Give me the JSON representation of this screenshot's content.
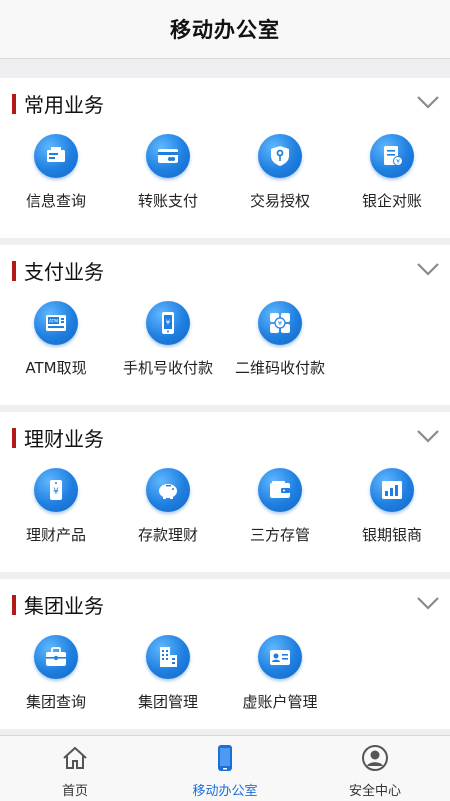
{
  "header": {
    "title": "移动办公室"
  },
  "sections": [
    {
      "title": "常用业务",
      "items": [
        {
          "label": "信息查询",
          "icon": "info-board-icon"
        },
        {
          "label": "转账支付",
          "icon": "card-icon"
        },
        {
          "label": "交易授权",
          "icon": "shield-key-icon"
        },
        {
          "label": "银企对账",
          "icon": "document-yen-icon"
        }
      ]
    },
    {
      "title": "支付业务",
      "items": [
        {
          "label": "ATM取现",
          "icon": "atm-icon"
        },
        {
          "label": "手机号收付款",
          "icon": "phone-yen-icon"
        },
        {
          "label": "二维码收付款",
          "icon": "grid-yen-icon"
        }
      ]
    },
    {
      "title": "理财业务",
      "items": [
        {
          "label": "理财产品",
          "icon": "tag-yen-icon"
        },
        {
          "label": "存款理财",
          "icon": "piggy-bank-icon"
        },
        {
          "label": "三方存管",
          "icon": "wallet-icon"
        },
        {
          "label": "银期银商",
          "icon": "bar-chart-icon"
        }
      ]
    },
    {
      "title": "集团业务",
      "items": [
        {
          "label": "集团查询",
          "icon": "briefcase-icon"
        },
        {
          "label": "集团管理",
          "icon": "building-icon"
        },
        {
          "label": "虚账户管理",
          "icon": "id-card-icon"
        }
      ]
    }
  ],
  "tabbar": {
    "tabs": [
      {
        "label": "首页",
        "icon": "home-icon"
      },
      {
        "label": "移动办公室",
        "icon": "mobile-phone-icon",
        "active": true
      },
      {
        "label": "安全中心",
        "icon": "user-circle-icon"
      }
    ]
  },
  "colors": {
    "accent": "#1a6fd8",
    "section_bar": "#b31b1b",
    "icon_blue": "#1f7fe0"
  }
}
